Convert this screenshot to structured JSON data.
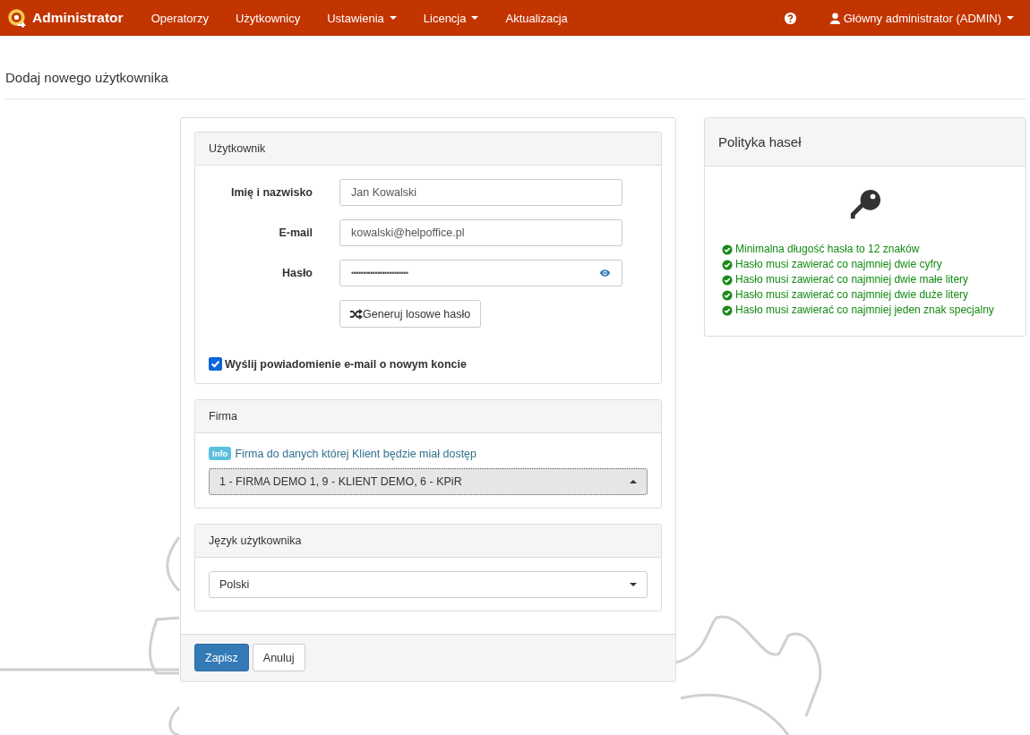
{
  "navbar": {
    "brand": "Administrator",
    "items": [
      {
        "label": "Operatorzy",
        "dropdown": false
      },
      {
        "label": "Użytkownicy",
        "dropdown": false
      },
      {
        "label": "Ustawienia",
        "dropdown": true
      },
      {
        "label": "Licencja",
        "dropdown": true
      },
      {
        "label": "Aktualizacja",
        "dropdown": false
      }
    ],
    "user": {
      "label": "Główny administrator (ADMIN)",
      "dropdown": true
    }
  },
  "page_title": "Dodaj nowego użytkownika",
  "user_section": {
    "title": "Użytkownik",
    "fields": [
      {
        "label": "Imię i nazwisko",
        "value": "Jan Kowalski",
        "kind": "text"
      },
      {
        "label": "E-mail",
        "value": "kowalski@helpoffice.pl",
        "kind": "text"
      },
      {
        "label": "Hasło",
        "value": "••••••••••••••••••••••••",
        "kind": "password"
      }
    ],
    "generate_button": "Generuj losowe hasło",
    "notify": {
      "label": "Wyślij powiadomienie e-mail o nowym koncie",
      "checked": true
    }
  },
  "company_section": {
    "title": "Firma",
    "info_badge": "Info",
    "info_text": "Firma do danych której Klient będzie miał dostęp",
    "select": {
      "value": "1 - FIRMA DEMO 1, 9 - KLIENT DEMO, 6 - KPiR",
      "expanded": true
    }
  },
  "language_section": {
    "title": "Język użytkownika",
    "select": {
      "value": "Polski",
      "expanded": false
    }
  },
  "buttons": [
    {
      "label": "Zapisz",
      "kind": "primary"
    },
    {
      "label": "Anuluj",
      "kind": "default"
    }
  ],
  "password_policy": {
    "title": "Polityka haseł",
    "rules": [
      {
        "text": "Minimalna długość hasła to 12 znaków",
        "met": true
      },
      {
        "text": "Hasło musi zawierać co najmniej dwie cyfry",
        "met": true
      },
      {
        "text": "Hasło musi zawierać co najmniej dwie małe litery",
        "met": true
      },
      {
        "text": "Hasło musi zawierać co najmniej dwie duże litery",
        "met": true
      },
      {
        "text": "Hasło musi zawierać co najmniej jeden znak specjalny",
        "met": true
      }
    ]
  }
}
